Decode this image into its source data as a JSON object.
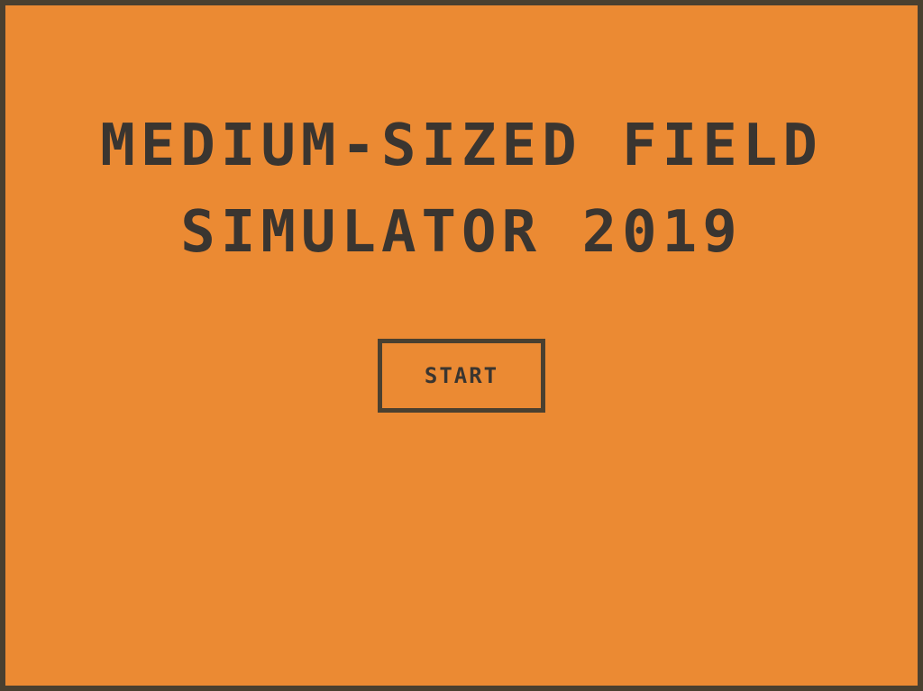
{
  "title": {
    "line1": "MEDIUM-SIZED FIELD",
    "line2": "SIMULATOR 2019"
  },
  "menu": {
    "start_label": "START"
  },
  "colors": {
    "background": "#eb8a33",
    "frame": "#4a4030",
    "text": "#3a3530"
  }
}
